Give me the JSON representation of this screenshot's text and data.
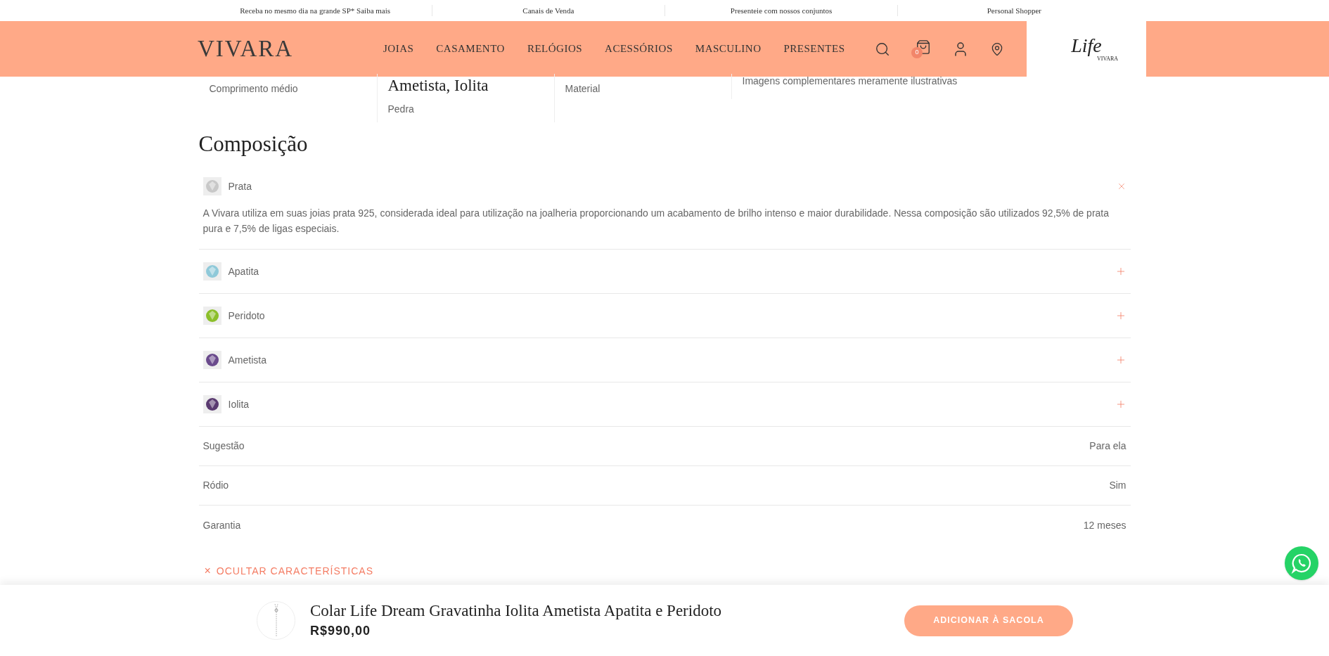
{
  "top_bar": [
    "Receba no mesmo dia na grande SP* Saiba mais",
    "Canais de Venda",
    "Presenteie com nossos conjuntos",
    "Personal Shopper"
  ],
  "header": {
    "logo": "VIVARA",
    "nav": [
      "JOIAS",
      "CASAMENTO",
      "RELÓGIOS",
      "ACESSÓRIOS",
      "MASCULINO",
      "PRESENTES"
    ],
    "cart_count": "0",
    "sub_logo": {
      "script": "Life",
      "brand": "VIVARA"
    }
  },
  "specs": [
    {
      "label": "Comprimento médio"
    },
    {
      "value": "Ametista, Iolita",
      "label": "Pedra"
    },
    {
      "label": "Material"
    },
    {
      "label": "Imagens complementares meramente ilustrativas"
    }
  ],
  "composition": {
    "title": "Composição",
    "items": [
      {
        "name": "Prata",
        "color": "#c8c8c8",
        "expanded": true,
        "text": "A Vivara utiliza em suas joias prata 925, considerada ideal para utilização na joalheria proporcionando um acabamento de brilho intenso e maior durabilidade. Nessa composição são utilizados 92,5% de prata pura e 7,5% de ligas especiais."
      },
      {
        "name": "Apatita",
        "color": "#8fc9d9",
        "expanded": false
      },
      {
        "name": "Peridoto",
        "color": "#8cbf2a",
        "expanded": false
      },
      {
        "name": "Ametista",
        "color": "#6a4a8c",
        "expanded": false
      },
      {
        "name": "Iolita",
        "color": "#5a3a70",
        "expanded": false
      }
    ]
  },
  "attributes": [
    {
      "label": "Sugestão",
      "value": "Para ela"
    },
    {
      "label": "Ródio",
      "value": "Sim"
    },
    {
      "label": "Garantia",
      "value": "12 meses"
    }
  ],
  "hide_link": {
    "icon": "×",
    "label": "OCULTAR CARACTERÍSTICAS"
  },
  "sticky_bar": {
    "title": "Colar Life Dream Gravatinha Iolita Ametista Apatita e Peridoto",
    "price": "R$990,00",
    "button": "ADICIONAR À SACOLA"
  }
}
